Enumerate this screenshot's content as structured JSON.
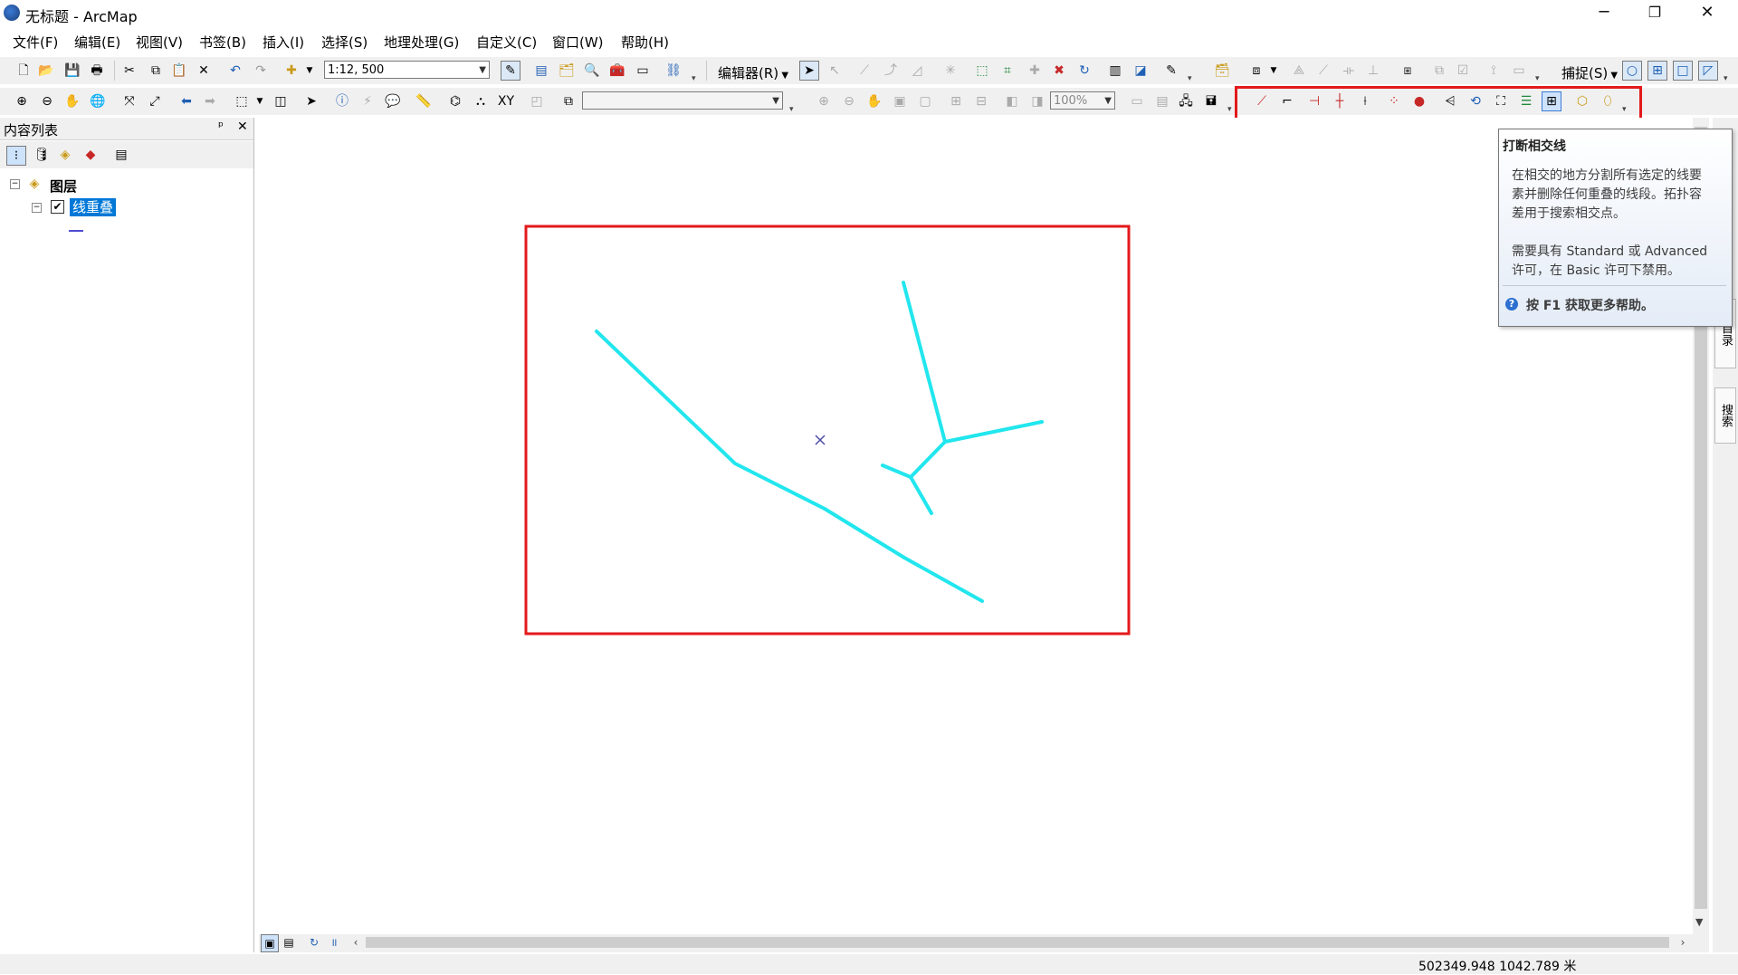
{
  "window": {
    "title": "无标题 - ArcMap",
    "minimize": "─",
    "restore": "❐",
    "close": "✕"
  },
  "menu": [
    "文件(F)",
    "编辑(E)",
    "视图(V)",
    "书签(B)",
    "插入(I)",
    "选择(S)",
    "地理处理(G)",
    "自定义(C)",
    "窗口(W)",
    "帮助(H)"
  ],
  "toolbar": {
    "scale": "1:12, 500",
    "editor_label": "编辑器(R)",
    "snapping_label": "捕捉(S)",
    "zoom_percent": "100%"
  },
  "toc": {
    "title": "内容列表",
    "pin": "ᵖ",
    "close": "✕",
    "group_label": "图层",
    "layer_label": "线重叠"
  },
  "tooltip": {
    "title": "打断相交线",
    "line1": "在相交的地方分割所有选定的线要",
    "line2": "素并删除任何重叠的线段。拓扑容",
    "line3": "差用于搜索相交点。",
    "line4": "需要具有 Standard 或 Advanced",
    "line5": "许可，在 Basic 许可下禁用。",
    "help": "按 F1 获取更多帮助。"
  },
  "side_tabs": [
    "目录",
    "搜索"
  ],
  "status": {
    "coords": "502349.948  1042.789 米"
  },
  "colors": {
    "feature": "#22e6ee",
    "highlight": "#e3191b",
    "selection": "#0078d7"
  }
}
